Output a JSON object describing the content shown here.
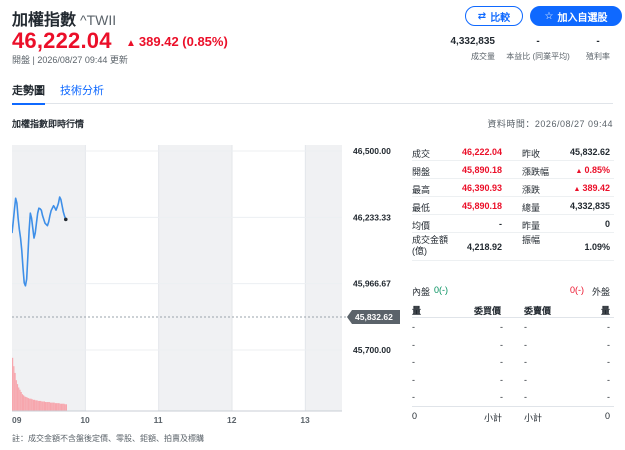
{
  "header": {
    "title": "加權指數",
    "symbol": "^TWII",
    "price": "46,222.04",
    "change": "389.42 (0.85%)",
    "meta": "開盤 | 2026/08/27 09:44 更新",
    "compare_label": "比較",
    "watchlist_label": "加入自選股",
    "stats": [
      {
        "value": "4,332,835",
        "label": "成交量"
      },
      {
        "value": "-",
        "label": "本益比 (同業平均)"
      },
      {
        "value": "-",
        "label": "殖利率"
      }
    ]
  },
  "tabs": [
    {
      "label": "走勢圖"
    },
    {
      "label": "技術分析"
    }
  ],
  "section": {
    "title": "加權指數即時行情",
    "data_time": "資料時間：2026/08/27 09:44"
  },
  "chart_data": {
    "type": "line",
    "y_ticks": [
      "46,500.00",
      "46,233.33",
      "45,966.67",
      "45,700.00"
    ],
    "ylim": [
      45700,
      46500
    ],
    "reference": {
      "value": 45832.62,
      "label": "45,832.62"
    },
    "x_ticks": [
      "09",
      "10",
      "11",
      "12",
      "13"
    ],
    "session": {
      "start": "09:00",
      "end": "13:30"
    },
    "series": [
      {
        "x": [
          0,
          1,
          2,
          3,
          4,
          5,
          6,
          7,
          8,
          9,
          10,
          11,
          12,
          13,
          14,
          15,
          16,
          17,
          18,
          19,
          20,
          21,
          22,
          23,
          24,
          25,
          26,
          27,
          28,
          29,
          30,
          31,
          32,
          33,
          34,
          35,
          36,
          37,
          38,
          39,
          40,
          41,
          42,
          43,
          44
        ],
        "values": [
          46170,
          46215,
          46265,
          46310,
          46290,
          46230,
          46185,
          46150,
          46100,
          46030,
          45970,
          45958,
          45985,
          46080,
          46180,
          46250,
          46230,
          46190,
          46150,
          46170,
          46210,
          46250,
          46270,
          46268,
          46262,
          46240,
          46225,
          46210,
          46205,
          46200,
          46215,
          46240,
          46260,
          46270,
          46280,
          46272,
          46262,
          46275,
          46290,
          46315,
          46305,
          46280,
          46255,
          46238,
          46225
        ]
      }
    ],
    "volume": {
      "x": [
        0,
        1,
        2,
        3,
        4,
        5,
        6,
        7,
        8,
        9,
        10,
        11,
        12,
        13,
        14,
        15,
        16,
        17,
        18,
        19,
        20,
        21,
        22,
        23,
        24,
        25,
        26,
        27,
        28,
        29,
        30,
        31,
        32,
        33,
        34,
        35,
        36,
        37,
        38,
        39,
        40,
        41,
        42,
        43,
        44
      ],
      "values": [
        95,
        80,
        68,
        55,
        48,
        42,
        38,
        34,
        30,
        28,
        26,
        25,
        24,
        23,
        22,
        22,
        21,
        20,
        20,
        19,
        19,
        18,
        18,
        18,
        17,
        17,
        17,
        16,
        16,
        16,
        16,
        15,
        15,
        15,
        15,
        14,
        14,
        14,
        14,
        13,
        13,
        13,
        13,
        12,
        12
      ]
    },
    "colors": {
      "line": "#3e8fe8",
      "reference": "#9aa3ab",
      "reference_badge": "#5b636a",
      "volume": "#f7a6ad",
      "band": "#f0f1f3"
    }
  },
  "quote": {
    "left": [
      {
        "label": "成交",
        "value": "46,222.04",
        "color": "red"
      },
      {
        "label": "開盤",
        "value": "45,890.18",
        "color": "red"
      },
      {
        "label": "最高",
        "value": "46,390.93",
        "color": "red"
      },
      {
        "label": "最低",
        "value": "45,890.18",
        "color": "red"
      },
      {
        "label": "均價",
        "value": "-",
        "color": "dark"
      },
      {
        "label": "成交金額 (億)",
        "value": "4,218.92",
        "color": "dark"
      }
    ],
    "right": [
      {
        "label": "昨收",
        "value": "45,832.62",
        "color": "dark"
      },
      {
        "label": "漲跌幅",
        "value": "0.85%",
        "color": "red",
        "arrow": "up"
      },
      {
        "label": "漲跌",
        "value": "389.42",
        "color": "red",
        "arrow": "up"
      },
      {
        "label": "總量",
        "value": "4,332,835",
        "color": "dark"
      },
      {
        "label": "昨量",
        "value": "0",
        "color": "dark"
      },
      {
        "label": "振幅",
        "value": "1.09%",
        "color": "dark"
      }
    ]
  },
  "orderbook": {
    "inner_label": "內盤",
    "inner_value": "0(-)",
    "outer_value": "0(-)",
    "outer_label": "外盤",
    "col_qty": "量",
    "col_bid": "委買價",
    "col_ask": "委賣價",
    "rows": [
      "-",
      "-",
      "-",
      "-",
      "-"
    ],
    "total_left": "0",
    "subtotal_label": "小計",
    "total_right": "0"
  },
  "note": "註：成交金額不含盤後定價、零股、鉅額、拍賣及標購"
}
